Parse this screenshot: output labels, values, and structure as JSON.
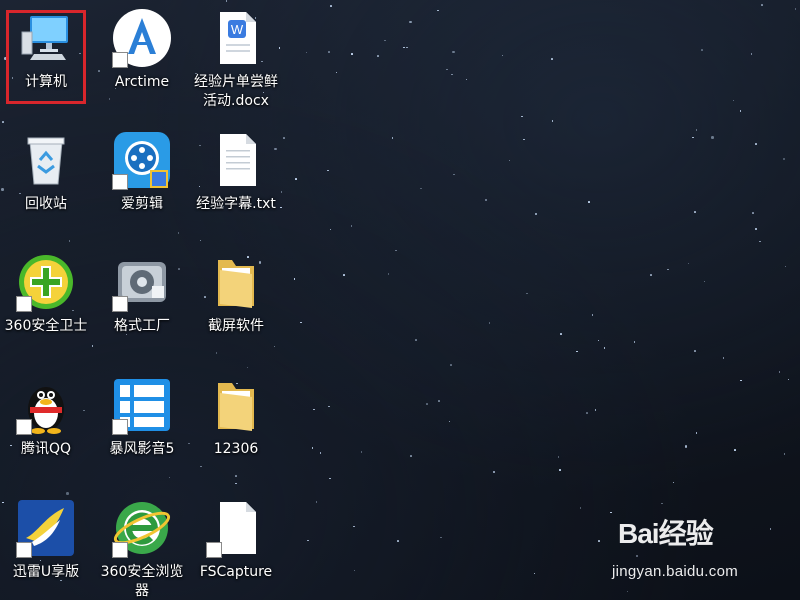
{
  "desktop": {
    "icons": [
      {
        "label": "计算机",
        "icon": "computer-icon",
        "shortcut": false,
        "selected": true
      },
      {
        "label": "Arctime",
        "icon": "arctime-icon",
        "shortcut": true,
        "selected": false
      },
      {
        "label": "经验片单尝鲜\n活动.docx",
        "icon": "word-document-icon",
        "shortcut": false,
        "selected": false
      },
      {
        "label": "回收站",
        "icon": "recycle-bin-icon",
        "shortcut": false,
        "selected": false
      },
      {
        "label": "爱剪辑",
        "icon": "aijianji-icon",
        "shortcut": true,
        "selected": false
      },
      {
        "label": "经验字幕.txt",
        "icon": "text-file-icon",
        "shortcut": false,
        "selected": false
      },
      {
        "label": "360安全卫士",
        "icon": "360-security-icon",
        "shortcut": true,
        "selected": false
      },
      {
        "label": "格式工厂",
        "icon": "format-factory-icon",
        "shortcut": true,
        "selected": false
      },
      {
        "label": "截屏软件",
        "icon": "folder-icon",
        "shortcut": false,
        "selected": false
      },
      {
        "label": "腾讯QQ",
        "icon": "qq-penguin-icon",
        "shortcut": true,
        "selected": false
      },
      {
        "label": "暴风影音5",
        "icon": "baofeng-icon",
        "shortcut": true,
        "selected": false
      },
      {
        "label": "12306",
        "icon": "folder-icon",
        "shortcut": false,
        "selected": false
      },
      {
        "label": "迅雷U享版",
        "icon": "xunlei-bird-icon",
        "shortcut": true,
        "selected": false
      },
      {
        "label": "360安全浏览\n器",
        "icon": "360-browser-icon",
        "shortcut": true,
        "selected": false
      },
      {
        "label": "FSCapture",
        "icon": "blank-file-icon",
        "shortcut": true,
        "selected": false
      }
    ]
  },
  "watermark": {
    "logo_text": "Bai经验",
    "url": "jingyan.baidu.com"
  },
  "colors": {
    "selection_border": "#d9262c",
    "label_text": "#ffffff"
  }
}
